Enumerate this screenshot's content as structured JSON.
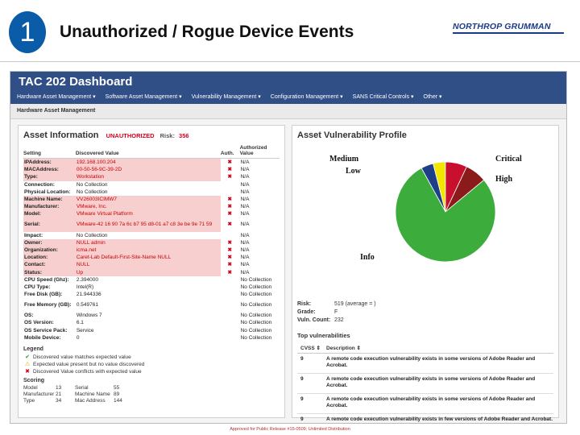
{
  "slide": {
    "number": "1",
    "title": "Unauthorized / Rogue Device Events",
    "logo": "NORTHROP GRUMMAN",
    "footer": "Approved for Public Release #15-0509; Unlimited Distribution"
  },
  "dashboard": {
    "title": "TAC 202 Dashboard",
    "nav": [
      "Hardware Asset Management ▾",
      "Software Asset Management ▾",
      "Vulnerability Management ▾",
      "Configuration Management ▾",
      "SANS Critical Controls ▾",
      "Other ▾"
    ],
    "breadcrumb": "Hardware Asset Management"
  },
  "asset_info": {
    "title": "Asset Information",
    "status": "UNAUTHORIZED",
    "risk_label": "Risk:",
    "risk_value": "356",
    "columns": [
      "Setting",
      "Discovered Value",
      "Auth.",
      "Authorized Value"
    ],
    "rows": [
      {
        "setting": "IPAddress:",
        "value": "192.168.100.204",
        "flag": "✖",
        "auth": "N/A",
        "bad": true,
        "tall": false
      },
      {
        "setting": "MACAddress:",
        "value": "00-50-56-9C-39-2D",
        "flag": "✖",
        "auth": "N/A",
        "bad": true,
        "tall": false
      },
      {
        "setting": "Type:",
        "value": "Workstation",
        "flag": "✖",
        "auth": "N/A",
        "bad": true,
        "tall": false
      },
      {
        "setting": "Connection:",
        "value": "No Collection",
        "flag": "",
        "auth": "N/A",
        "bad": false,
        "tall": false
      },
      {
        "setting": "Physical Location:",
        "value": "No Collection",
        "flag": "",
        "auth": "N/A",
        "bad": false,
        "tall": false
      },
      {
        "setting": "Machine Name:",
        "value": "VV26003ICIMW7",
        "flag": "✖",
        "auth": "N/A",
        "bad": true,
        "tall": false
      },
      {
        "setting": "Manufacturer:",
        "value": "VMware, Inc.",
        "flag": "✖",
        "auth": "N/A",
        "bad": true,
        "tall": false
      },
      {
        "setting": "Model:",
        "value": "VMware Virtual Platform",
        "flag": "✖",
        "auth": "N/A",
        "bad": true,
        "tall": false
      },
      {
        "setting": "Serial:",
        "value": "VMware-42 16 90 7a 6c b7 95 d8-01 a7 c8 3e be 9e 71 59",
        "flag": "✖",
        "auth": "N/A",
        "bad": true,
        "tall": true
      },
      {
        "setting": "Impact:",
        "value": "No Collection",
        "flag": "",
        "auth": "N/A",
        "bad": false,
        "tall": false
      },
      {
        "setting": "Owner:",
        "value": "NULL admin",
        "flag": "✖",
        "auth": "N/A",
        "bad": true,
        "tall": false
      },
      {
        "setting": "Organization:",
        "value": "icma.net",
        "flag": "✖",
        "auth": "N/A",
        "bad": true,
        "tall": false
      },
      {
        "setting": "Location:",
        "value": "Caret-Lab Default-First-Site-Name NULL",
        "flag": "✖",
        "auth": "N/A",
        "bad": true,
        "tall": false
      },
      {
        "setting": "Contact:",
        "value": "NULL",
        "flag": "✖",
        "auth": "N/A",
        "bad": true,
        "tall": false
      },
      {
        "setting": "Status:",
        "value": "Up",
        "flag": "✖",
        "auth": "N/A",
        "bad": true,
        "tall": false
      },
      {
        "setting": "CPU Speed (Ghz):",
        "value": "2.394000",
        "flag": "",
        "auth": "No Collection",
        "bad": false,
        "tall": false
      },
      {
        "setting": "CPU Type:",
        "value": "Intel(R)",
        "flag": "",
        "auth": "No Collection",
        "bad": false,
        "tall": false
      },
      {
        "setting": "Free Disk (GB):",
        "value": "21.944336",
        "flag": "",
        "auth": "No Collection",
        "bad": false,
        "tall": false
      },
      {
        "setting": "Free Memory (GB):",
        "value": "0.549761",
        "flag": "",
        "auth": "No Collection",
        "bad": false,
        "tall": true
      },
      {
        "setting": "OS:",
        "value": "Windows 7",
        "flag": "",
        "auth": "No Collection",
        "bad": false,
        "tall": false
      },
      {
        "setting": "OS Version:",
        "value": "6.1",
        "flag": "",
        "auth": "No Collection",
        "bad": false,
        "tall": false
      },
      {
        "setting": "OS Service Pack:",
        "value": "Service",
        "flag": "",
        "auth": "No Collection",
        "bad": false,
        "tall": false
      },
      {
        "setting": "Mobile Device:",
        "value": "0",
        "flag": "",
        "auth": "No Collection",
        "bad": false,
        "tall": false
      }
    ],
    "legend": {
      "title": "Legend",
      "items": [
        {
          "icon": "✔",
          "color": "#2e9a2e",
          "text": "Discovered value matches expected value"
        },
        {
          "icon": "⚠",
          "color": "#e0a800",
          "text": "Expected value present but no value discovered"
        },
        {
          "icon": "✖",
          "color": "#d6001c",
          "text": "Discovered Value conflicts with expected value"
        }
      ]
    },
    "scoring": {
      "title": "Scoring",
      "cells": [
        "Model",
        "13",
        "Serial",
        "55",
        "Manufacturer",
        "21",
        "Machine Name",
        "89",
        "Type",
        "34",
        "Mac Address",
        "144"
      ]
    }
  },
  "vuln_profile": {
    "title": "Asset Vulnerability Profile",
    "pie_labels": {
      "medium": "Medium",
      "low": "Low",
      "critical": "Critical",
      "high": "High",
      "info": "Info"
    },
    "metrics": [
      {
        "label": "Risk:",
        "value": "519 (average = )"
      },
      {
        "label": "Grade:",
        "value": "F"
      },
      {
        "label": "Vuln. Count:",
        "value": "232"
      }
    ],
    "top_title": "Top vulnerabilities",
    "columns": [
      "CVSS ⇕",
      "Description ⇕"
    ],
    "rows": [
      {
        "cvss": "9",
        "desc": "A remote code execution vulnerability exists in some versions of Adobe Reader and Acrobat."
      },
      {
        "cvss": "9",
        "desc": "A remote code execution vulnerability exists in some versions of Adobe Reader and Acrobat."
      },
      {
        "cvss": "9",
        "desc": "A remote code execution vulnerability exists in some versions of Adobe Reader and Acrobat."
      },
      {
        "cvss": "9",
        "desc": "A remote code execution vulnerability exists in few versions of Adobe Reader and Acrobat."
      },
      {
        "cvss": "9",
        "desc": "A remote code execution vulnerability exists in some versions of Adobe Reader and Acrobat."
      }
    ]
  },
  "chart_data": {
    "type": "pie",
    "categories": [
      "Info",
      "Critical",
      "High",
      "Medium",
      "Low"
    ],
    "values": [
      78,
      7,
      7,
      4,
      4
    ],
    "colors": [
      "#3cad3c",
      "#c8102e",
      "#8b1a1a",
      "#f2e600",
      "#1f3e8a"
    ]
  }
}
